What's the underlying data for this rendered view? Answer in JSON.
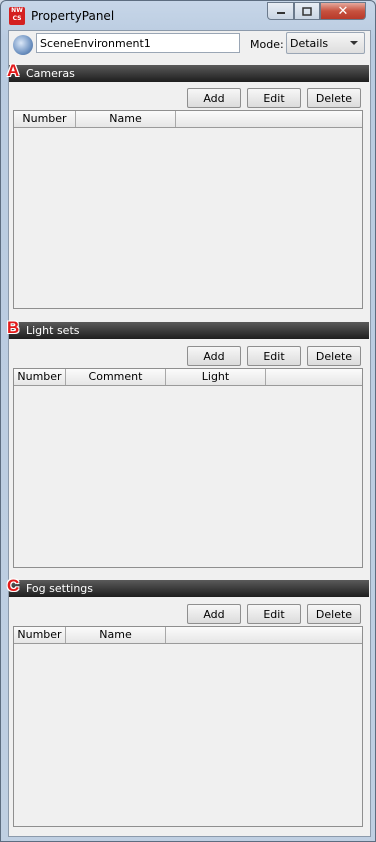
{
  "window": {
    "title": "PropertyPanel",
    "app_icon_lines": [
      "NW",
      "CS"
    ],
    "close_glyph": "✕"
  },
  "toolbar": {
    "scene_value": "SceneEnvironment1",
    "mode_label": "Mode:",
    "mode_value": "Details"
  },
  "sections": [
    {
      "badge": "A",
      "title": "Cameras",
      "buttons": [
        "Add",
        "Edit",
        "Delete"
      ],
      "columns": [
        "Number",
        "Name",
        ""
      ]
    },
    {
      "badge": "B",
      "title": "Light sets",
      "buttons": [
        "Add",
        "Edit",
        "Delete"
      ],
      "columns": [
        "Number",
        "Comment",
        "Light",
        ""
      ]
    },
    {
      "badge": "C",
      "title": "Fog settings",
      "buttons": [
        "Add",
        "Edit",
        "Delete"
      ],
      "columns": [
        "Number",
        "Name",
        ""
      ]
    }
  ]
}
